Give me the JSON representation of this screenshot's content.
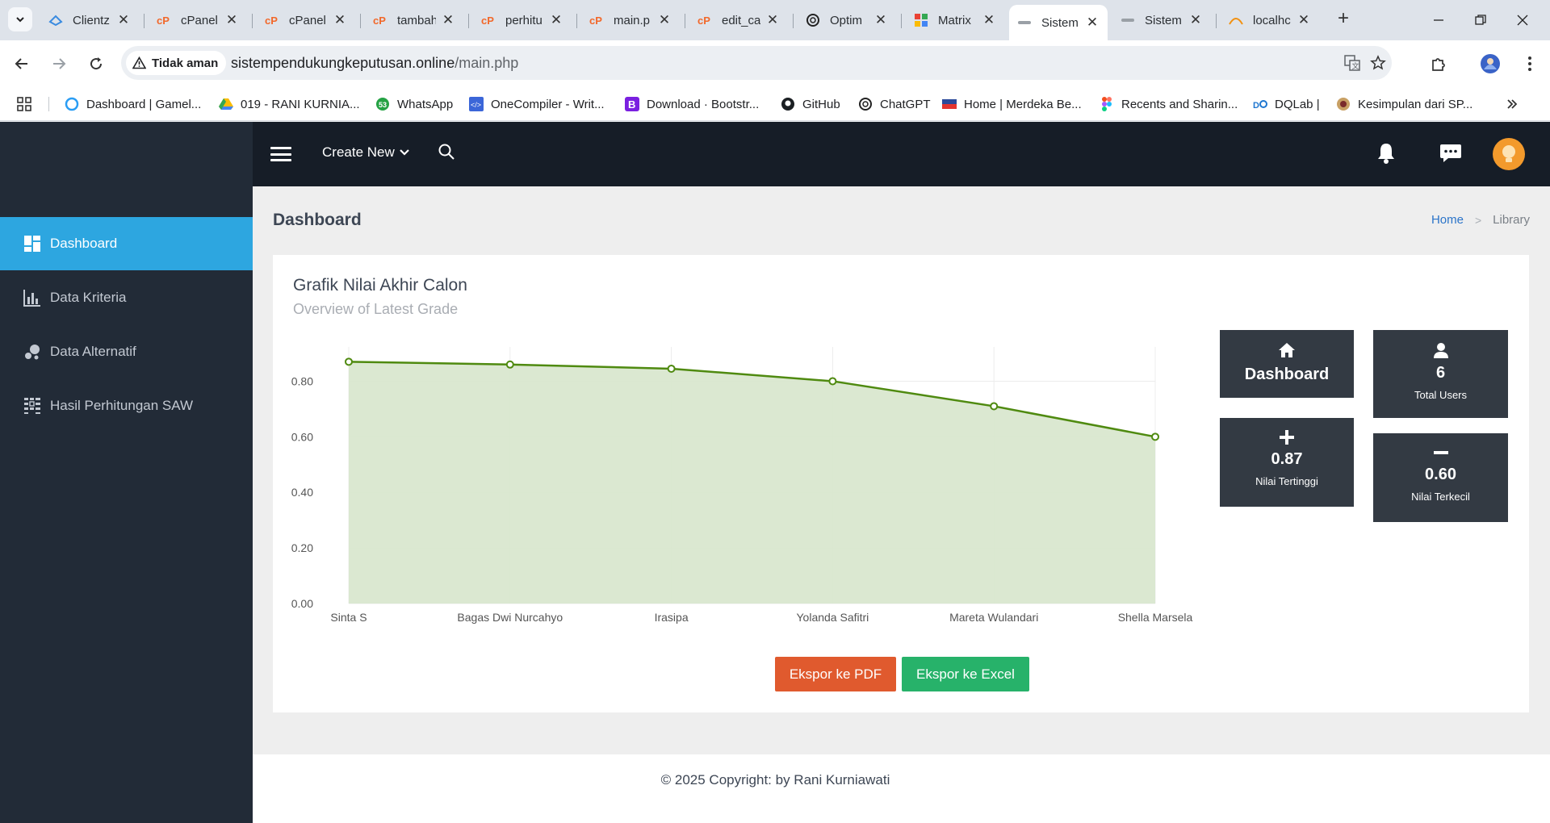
{
  "browser": {
    "tabs": [
      {
        "title": "Clientz",
        "icon": "cloud-icon"
      },
      {
        "title": "cPanel",
        "icon": "cpanel-icon"
      },
      {
        "title": "cPanel",
        "icon": "cpanel-icon"
      },
      {
        "title": "tambah",
        "icon": "cpanel-icon"
      },
      {
        "title": "perhitu",
        "icon": "cpanel-icon"
      },
      {
        "title": "main.p",
        "icon": "cpanel-icon"
      },
      {
        "title": "edit_ca",
        "icon": "cpanel-icon"
      },
      {
        "title": "Optim",
        "icon": "chatgpt-icon"
      },
      {
        "title": "Matrix",
        "icon": "grid-icon"
      },
      {
        "title": "Sistem",
        "icon": "site-icon"
      },
      {
        "title": "Sistem",
        "icon": "site-icon"
      },
      {
        "title": "localhc",
        "icon": "phpmyadmin-icon"
      }
    ],
    "security_label": "Tidak aman",
    "url_host": "sistempendukungkeputusan.online",
    "url_path": "/main.php",
    "bookmarks": [
      "Dashboard | Gamel...",
      "019 - RANI KURNIA...",
      "WhatsApp",
      "OneCompiler - Writ...",
      "Download · Bootstr...",
      "GitHub",
      "ChatGPT",
      "Home | Merdeka Be...",
      "Recents and Sharin...",
      "DQLab |",
      "Kesimpulan dari SP..."
    ]
  },
  "sidebar": {
    "items": [
      {
        "label": "Dashboard",
        "icon": "dashboard-icon",
        "active": true
      },
      {
        "label": "Data Kriteria",
        "icon": "bar-chart-icon",
        "active": false
      },
      {
        "label": "Data Alternatif",
        "icon": "bubbles-icon",
        "active": false
      },
      {
        "label": "Hasil Perhitungan SAW",
        "icon": "table-icon",
        "active": false
      }
    ]
  },
  "topnav": {
    "create_new": "Create New"
  },
  "page": {
    "title": "Dashboard",
    "breadcrumb_home": "Home",
    "breadcrumb_current": "Library"
  },
  "card": {
    "title": "Grafik Nilai Akhir Calon",
    "subtitle": "Overview of Latest Grade"
  },
  "chart_data": {
    "type": "area",
    "categories": [
      "Sinta S",
      "Bagas Dwi Nurcahyo",
      "Irasipa",
      "Yolanda Safitri",
      "Mareta Wulandari",
      "Shella Marsela"
    ],
    "values": [
      0.87,
      0.86,
      0.845,
      0.8,
      0.71,
      0.6
    ],
    "ylim": [
      0,
      0.9
    ],
    "yticks": [
      "0.00",
      "0.20",
      "0.40",
      "0.60",
      "0.80"
    ],
    "grid": true,
    "colors": {
      "line": "#4f8a10",
      "fill": "#d9e7cf"
    }
  },
  "stats": {
    "dashboard": {
      "label": "Dashboard",
      "icon": "home-icon"
    },
    "users": {
      "value": "6",
      "label": "Total Users",
      "icon": "user-icon"
    },
    "highest": {
      "value": "0.87",
      "label": "Nilai Tertinggi",
      "icon": "plus-icon"
    },
    "lowest": {
      "value": "0.60",
      "label": "Nilai Terkecil",
      "icon": "minus-icon"
    }
  },
  "buttons": {
    "pdf": "Ekspor ke PDF",
    "excel": "Ekspor ke Excel"
  },
  "footer": {
    "copyright": "© 2025 Copyright: by Rani Kurniawati"
  }
}
